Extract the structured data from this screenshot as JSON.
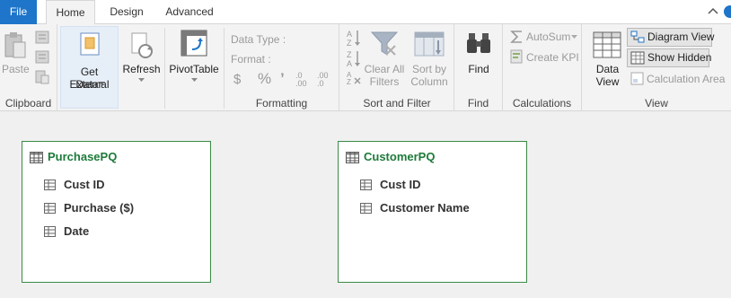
{
  "tabs": {
    "file": "File",
    "home": "Home",
    "design": "Design",
    "advanced": "Advanced"
  },
  "clipboard": {
    "label": "Clipboard",
    "paste": "Paste"
  },
  "get_data": {
    "line1": "Get External",
    "line2": "Data"
  },
  "refresh": {
    "label": "Refresh"
  },
  "pivot": {
    "label": "PivotTable"
  },
  "formatting": {
    "label": "Formatting",
    "data_type": "Data Type :",
    "format": "Format :",
    "currency": "$",
    "percent": "%",
    "comma": "’",
    "inc_dec": ".0 .00",
    "dec_dec": ".00 .0"
  },
  "sort_filter": {
    "label": "Sort and Filter",
    "clear1": "Clear All",
    "clear2": "Filters",
    "sort1": "Sort by",
    "sort2": "Column"
  },
  "find": {
    "label": "Find",
    "button": "Find"
  },
  "calculations": {
    "label": "Calculations",
    "autosum": "AutoSum",
    "create_kpi": "Create KPI"
  },
  "view": {
    "label": "View",
    "data_view1": "Data",
    "data_view2": "View",
    "diagram_view": "Diagram View",
    "show_hidden": "Show Hidden",
    "calc_area": "Calculation Area"
  },
  "tables": [
    {
      "name": "PurchasePQ",
      "columns": [
        "Cust ID",
        "Purchase ($)",
        "Date"
      ]
    },
    {
      "name": "CustomerPQ",
      "columns": [
        "Cust ID",
        "Customer Name"
      ]
    }
  ],
  "colors": {
    "accent": "#1e75c9",
    "table_border": "#3a8a45",
    "table_title": "#1e7a3a"
  }
}
